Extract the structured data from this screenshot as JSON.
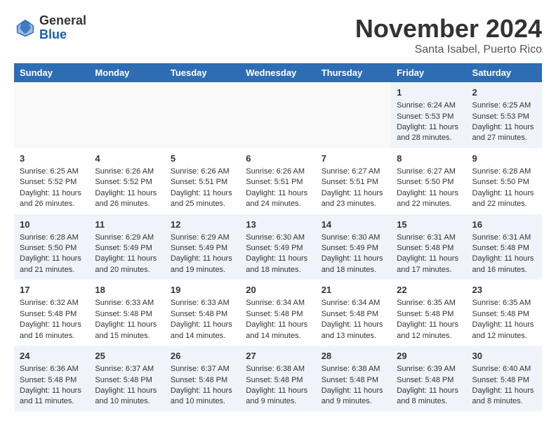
{
  "logo": {
    "general": "General",
    "blue": "Blue"
  },
  "header": {
    "month": "November 2024",
    "location": "Santa Isabel, Puerto Rico"
  },
  "days_of_week": [
    "Sunday",
    "Monday",
    "Tuesday",
    "Wednesday",
    "Thursday",
    "Friday",
    "Saturday"
  ],
  "weeks": [
    [
      {
        "day": "",
        "content": ""
      },
      {
        "day": "",
        "content": ""
      },
      {
        "day": "",
        "content": ""
      },
      {
        "day": "",
        "content": ""
      },
      {
        "day": "",
        "content": ""
      },
      {
        "day": "1",
        "content": "Sunrise: 6:24 AM\nSunset: 5:53 PM\nDaylight: 11 hours and 28 minutes."
      },
      {
        "day": "2",
        "content": "Sunrise: 6:25 AM\nSunset: 5:53 PM\nDaylight: 11 hours and 27 minutes."
      }
    ],
    [
      {
        "day": "3",
        "content": "Sunrise: 6:25 AM\nSunset: 5:52 PM\nDaylight: 11 hours and 26 minutes."
      },
      {
        "day": "4",
        "content": "Sunrise: 6:26 AM\nSunset: 5:52 PM\nDaylight: 11 hours and 26 minutes."
      },
      {
        "day": "5",
        "content": "Sunrise: 6:26 AM\nSunset: 5:51 PM\nDaylight: 11 hours and 25 minutes."
      },
      {
        "day": "6",
        "content": "Sunrise: 6:26 AM\nSunset: 5:51 PM\nDaylight: 11 hours and 24 minutes."
      },
      {
        "day": "7",
        "content": "Sunrise: 6:27 AM\nSunset: 5:51 PM\nDaylight: 11 hours and 23 minutes."
      },
      {
        "day": "8",
        "content": "Sunrise: 6:27 AM\nSunset: 5:50 PM\nDaylight: 11 hours and 22 minutes."
      },
      {
        "day": "9",
        "content": "Sunrise: 6:28 AM\nSunset: 5:50 PM\nDaylight: 11 hours and 22 minutes."
      }
    ],
    [
      {
        "day": "10",
        "content": "Sunrise: 6:28 AM\nSunset: 5:50 PM\nDaylight: 11 hours and 21 minutes."
      },
      {
        "day": "11",
        "content": "Sunrise: 6:29 AM\nSunset: 5:49 PM\nDaylight: 11 hours and 20 minutes."
      },
      {
        "day": "12",
        "content": "Sunrise: 6:29 AM\nSunset: 5:49 PM\nDaylight: 11 hours and 19 minutes."
      },
      {
        "day": "13",
        "content": "Sunrise: 6:30 AM\nSunset: 5:49 PM\nDaylight: 11 hours and 18 minutes."
      },
      {
        "day": "14",
        "content": "Sunrise: 6:30 AM\nSunset: 5:49 PM\nDaylight: 11 hours and 18 minutes."
      },
      {
        "day": "15",
        "content": "Sunrise: 6:31 AM\nSunset: 5:48 PM\nDaylight: 11 hours and 17 minutes."
      },
      {
        "day": "16",
        "content": "Sunrise: 6:31 AM\nSunset: 5:48 PM\nDaylight: 11 hours and 16 minutes."
      }
    ],
    [
      {
        "day": "17",
        "content": "Sunrise: 6:32 AM\nSunset: 5:48 PM\nDaylight: 11 hours and 16 minutes."
      },
      {
        "day": "18",
        "content": "Sunrise: 6:33 AM\nSunset: 5:48 PM\nDaylight: 11 hours and 15 minutes."
      },
      {
        "day": "19",
        "content": "Sunrise: 6:33 AM\nSunset: 5:48 PM\nDaylight: 11 hours and 14 minutes."
      },
      {
        "day": "20",
        "content": "Sunrise: 6:34 AM\nSunset: 5:48 PM\nDaylight: 11 hours and 14 minutes."
      },
      {
        "day": "21",
        "content": "Sunrise: 6:34 AM\nSunset: 5:48 PM\nDaylight: 11 hours and 13 minutes."
      },
      {
        "day": "22",
        "content": "Sunrise: 6:35 AM\nSunset: 5:48 PM\nDaylight: 11 hours and 12 minutes."
      },
      {
        "day": "23",
        "content": "Sunrise: 6:35 AM\nSunset: 5:48 PM\nDaylight: 11 hours and 12 minutes."
      }
    ],
    [
      {
        "day": "24",
        "content": "Sunrise: 6:36 AM\nSunset: 5:48 PM\nDaylight: 11 hours and 11 minutes."
      },
      {
        "day": "25",
        "content": "Sunrise: 6:37 AM\nSunset: 5:48 PM\nDaylight: 11 hours and 10 minutes."
      },
      {
        "day": "26",
        "content": "Sunrise: 6:37 AM\nSunset: 5:48 PM\nDaylight: 11 hours and 10 minutes."
      },
      {
        "day": "27",
        "content": "Sunrise: 6:38 AM\nSunset: 5:48 PM\nDaylight: 11 hours and 9 minutes."
      },
      {
        "day": "28",
        "content": "Sunrise: 6:38 AM\nSunset: 5:48 PM\nDaylight: 11 hours and 9 minutes."
      },
      {
        "day": "29",
        "content": "Sunrise: 6:39 AM\nSunset: 5:48 PM\nDaylight: 11 hours and 8 minutes."
      },
      {
        "day": "30",
        "content": "Sunrise: 6:40 AM\nSunset: 5:48 PM\nDaylight: 11 hours and 8 minutes."
      }
    ]
  ]
}
